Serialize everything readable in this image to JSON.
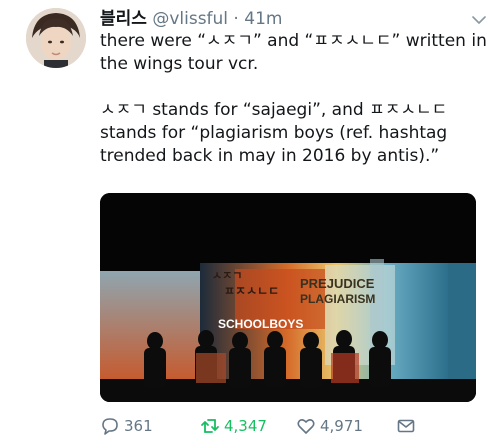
{
  "tweet": {
    "display_name": "블리스",
    "handle": "@vlissful",
    "separator": " · ",
    "time": "41m",
    "paragraphs": [
      "there were “ㅅㅈㄱ” and “ㅍㅈㅅㄴㄷ” written in the wings tour vcr.",
      "ㅅㅈㄱ stands for “sajaegi”, and ㅍㅈㅅㄴㄷ stands for “plagiarism boys (ref. hashtag trended back in may in 2016 by antis).”"
    ]
  },
  "media": {
    "screen_text_1": "PREJUDICE",
    "screen_text_2": "PLAGIARISM",
    "screen_text_3": "ㅍㅈㅅㄴㄷ",
    "screen_text_4": "ㅅㅈㄱ",
    "screen_text_5": "SCHOOLBOYS"
  },
  "actions": {
    "replies": "361",
    "retweets": "4,347",
    "likes": "4,971"
  },
  "icons": {
    "reply": "reply-icon",
    "retweet": "retweet-icon",
    "like": "heart-icon",
    "dm": "envelope-icon",
    "more": "chevron-down-icon"
  },
  "colors": {
    "text": "#14171a",
    "muted": "#657786",
    "retweet_active": "#17bf63"
  }
}
